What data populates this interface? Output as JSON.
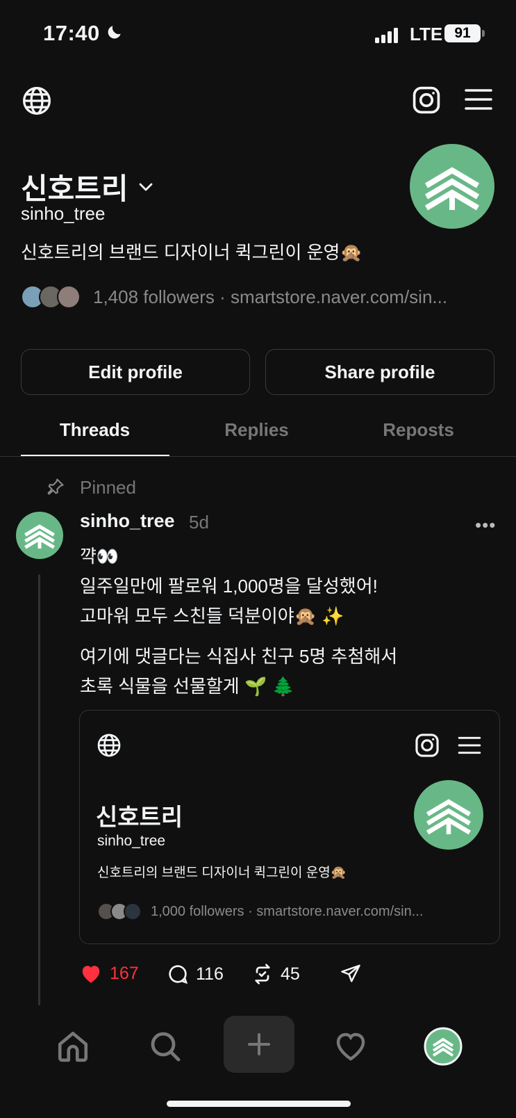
{
  "status_bar": {
    "time": "17:40",
    "network": "LTE",
    "battery": "91"
  },
  "profile": {
    "display_name": "신호트리",
    "username": "sinho_tree",
    "bio": "신호트리의 브랜드 디자이너 퀵그린이 운영🙊",
    "followers_text": "1,408 followers · smartstore.naver.com/sin...",
    "edit_label": "Edit profile",
    "share_label": "Share profile"
  },
  "tabs": [
    {
      "label": "Threads",
      "active": true
    },
    {
      "label": "Replies",
      "active": false
    },
    {
      "label": "Reposts",
      "active": false
    }
  ],
  "post": {
    "pinned_label": "Pinned",
    "username": "sinho_tree",
    "time": "5d",
    "lines": [
      "꺅👀",
      "일주일만에 팔로워 1,000명을 달성했어!",
      "고마워 모두 스친들 덕분이야🙊 ✨",
      "여기에 댓글다는 식집사 친구 5명 추첨해서",
      "초록 식물을 선물할게 🌱 🌲"
    ],
    "card": {
      "display_name": "신호트리",
      "username": "sinho_tree",
      "bio": "신호트리의 브랜드 디자이너 퀵그린이 운영🙊",
      "followers_text": "1,000 followers · smartstore.naver.com/sin..."
    },
    "likes": "167",
    "replies": "116",
    "reposts": "45"
  },
  "colors": {
    "accent": "#68b887",
    "like": "#ff3040",
    "background": "#101010"
  },
  "icons": [
    "globe-icon",
    "instagram-icon",
    "menu-icon",
    "chevron-down-icon",
    "pin-icon",
    "more-icon",
    "heart-icon",
    "comment-icon",
    "repost-icon",
    "send-icon",
    "home-icon",
    "search-icon",
    "plus-icon",
    "activity-icon"
  ]
}
